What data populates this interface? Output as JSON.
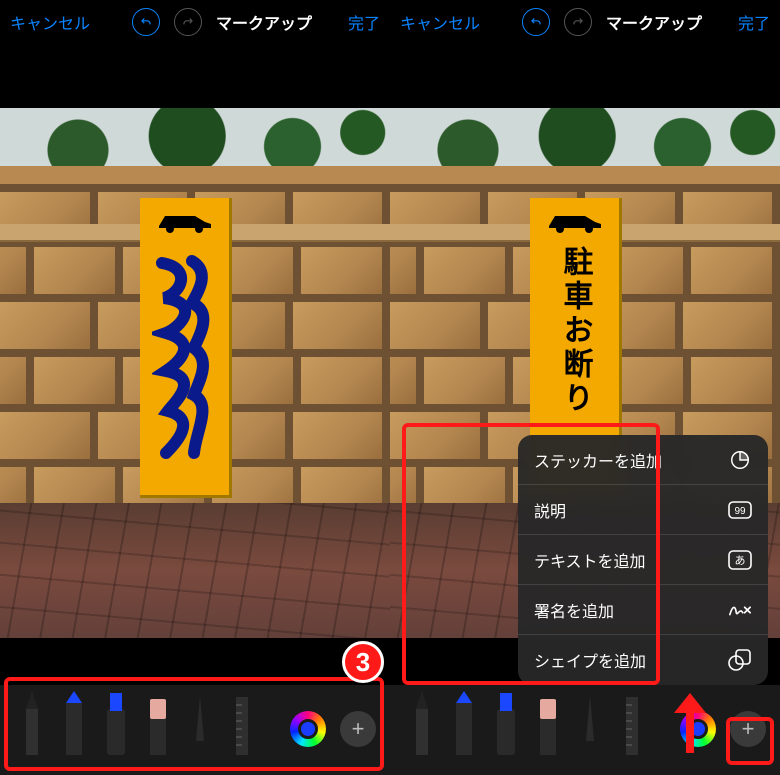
{
  "nav": {
    "cancel": "キャンセル",
    "title": "マークアップ",
    "done": "完了"
  },
  "sign": {
    "text": "駐車お断り"
  },
  "tools": {
    "plus": "+",
    "color_current": "#1a3dff"
  },
  "menu": {
    "items": [
      {
        "label": "ステッカーを追加",
        "icon": "sticker-icon"
      },
      {
        "label": "説明",
        "icon": "caption-icon"
      },
      {
        "label": "テキストを追加",
        "icon": "text-icon"
      },
      {
        "label": "署名を追加",
        "icon": "signature-icon"
      },
      {
        "label": "シェイプを追加",
        "icon": "shape-icon"
      }
    ]
  },
  "annotation": {
    "step": "3"
  }
}
